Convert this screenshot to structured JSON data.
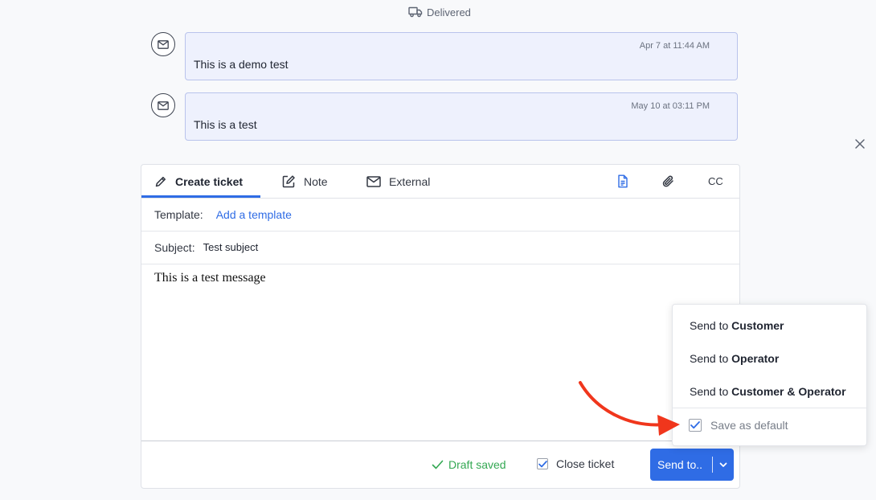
{
  "status": {
    "label": "Delivered",
    "icon": "truck-icon"
  },
  "messages": [
    {
      "timestamp": "Apr 7 at 11:44 AM",
      "text": "This is a demo test",
      "icon": "mail-icon"
    },
    {
      "timestamp": "May 10 at 03:11 PM",
      "text": "This is a test",
      "icon": "mail-icon"
    }
  ],
  "composer": {
    "tabs": [
      {
        "label": "Create ticket",
        "icon": "pencil-icon",
        "active": true
      },
      {
        "label": "Note",
        "icon": "edit-icon",
        "active": false
      },
      {
        "label": "External",
        "icon": "mail-icon",
        "active": false
      }
    ],
    "toolbar": {
      "cc_label": "CC",
      "icons": [
        "document-icon",
        "paperclip-icon"
      ]
    },
    "template": {
      "label": "Template:",
      "link": "Add a template"
    },
    "subject": {
      "label": "Subject:",
      "value": "Test subject"
    },
    "body": "This is a test message",
    "footer": {
      "draft_status": "Draft saved",
      "close_ticket_label": "Close ticket",
      "close_ticket_checked": true,
      "send_button_label": "Send to.."
    }
  },
  "send_dropdown": {
    "options": [
      {
        "prefix": "Send to",
        "target": "Customer"
      },
      {
        "prefix": "Send to",
        "target": "Operator"
      },
      {
        "prefix": "Send to",
        "target": "Customer & Operator"
      }
    ],
    "save_default_label": "Save as default",
    "save_default_checked": true
  },
  "colors": {
    "accent": "#2f6ce5",
    "success": "#34a853",
    "annotation_arrow": "#f0361c",
    "bubble_bg": "#eef1fd"
  }
}
